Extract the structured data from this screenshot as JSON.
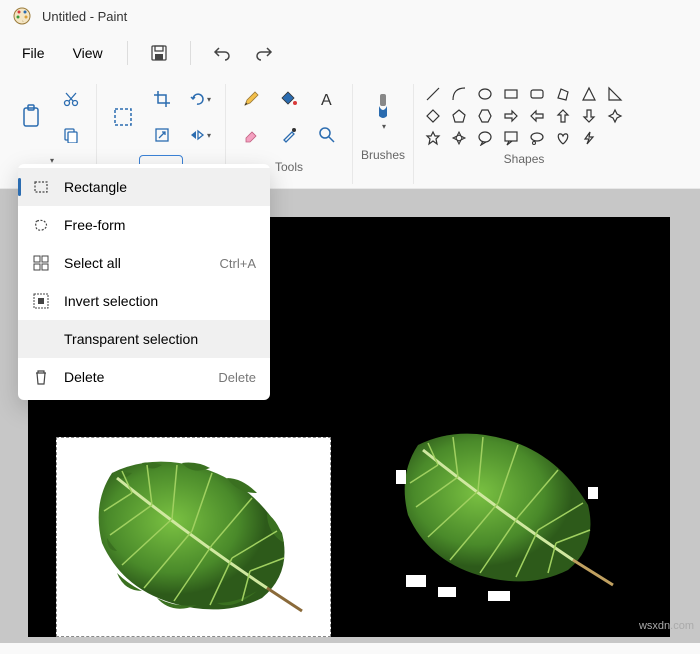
{
  "title": "Untitled - Paint",
  "menubar": {
    "file": "File",
    "view": "View"
  },
  "ribbon": {
    "tools_label": "Tools",
    "brushes_label": "Brushes",
    "shapes_label": "Shapes"
  },
  "dropdown": {
    "rectangle": "Rectangle",
    "freeform": "Free-form",
    "select_all": "Select all",
    "select_all_shortcut": "Ctrl+A",
    "invert": "Invert selection",
    "transparent": "Transparent selection",
    "delete": "Delete",
    "delete_shortcut": "Delete"
  },
  "watermark": "wsxdn.com"
}
